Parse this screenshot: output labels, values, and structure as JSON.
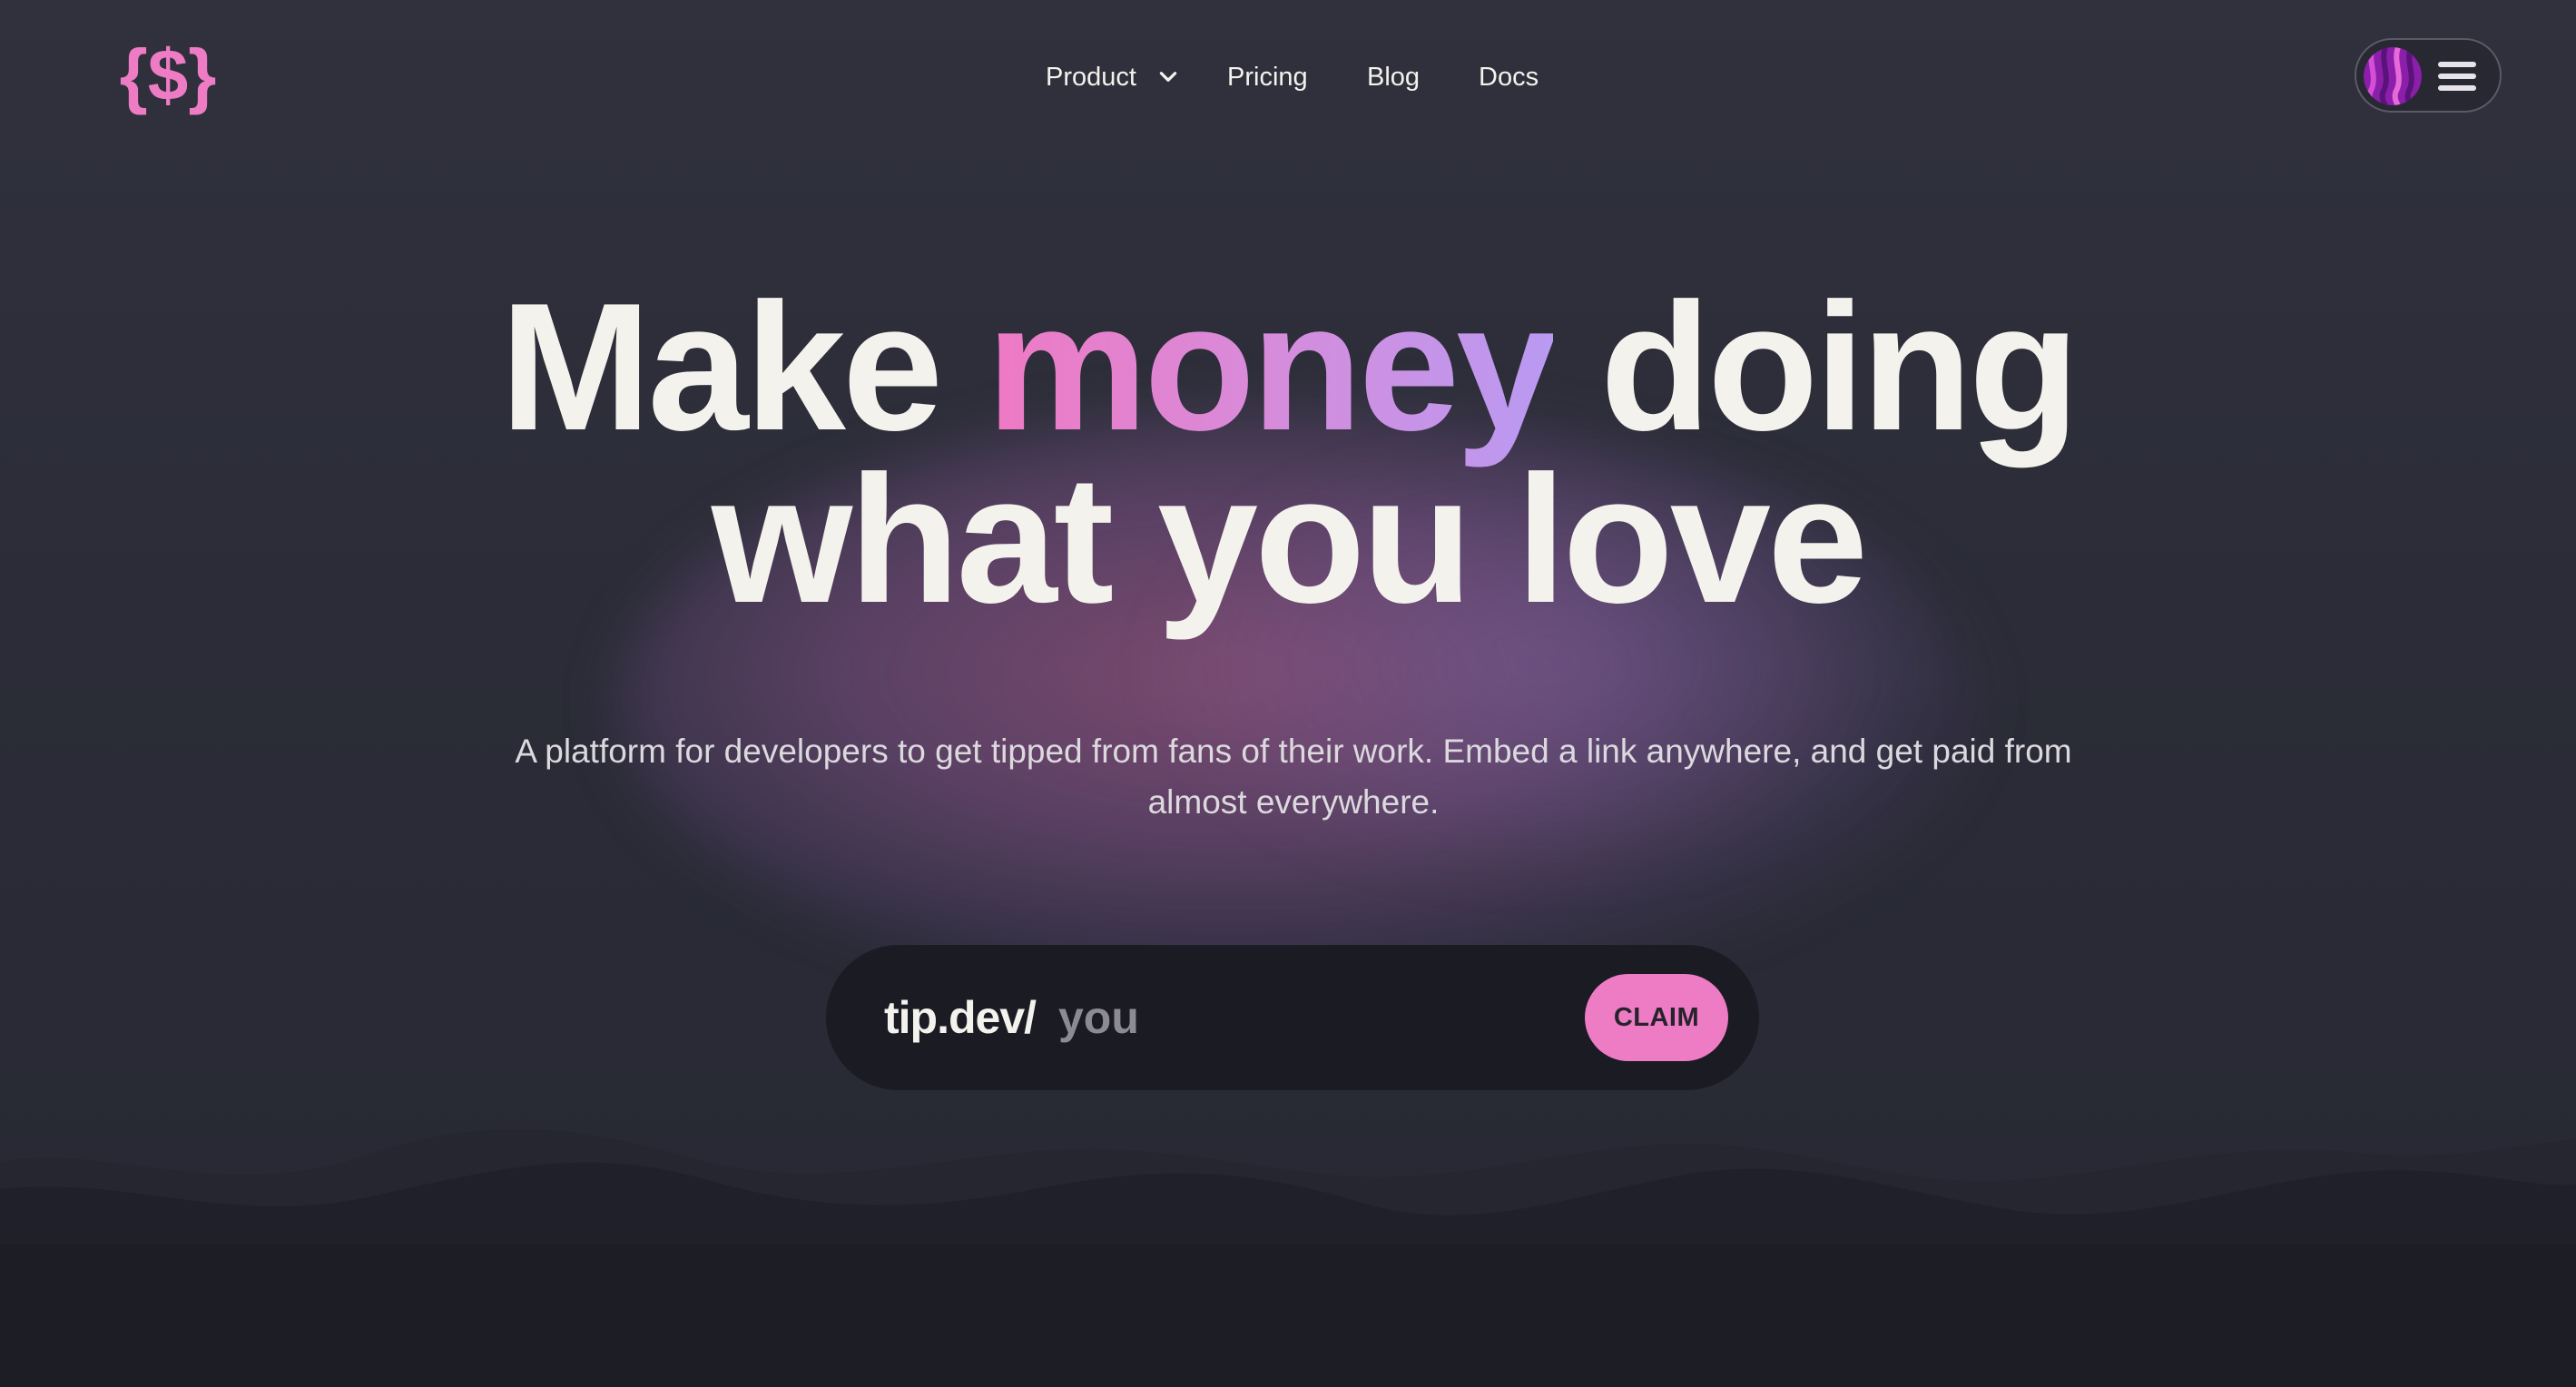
{
  "colors": {
    "background": "#2b2c38",
    "accent_pink": "#ee7cc5",
    "accent_purple": "#b99af2",
    "text": "#f4f2ec",
    "claim_bar": "#1b1b24"
  },
  "header": {
    "logo_icon": "curly-brace-dollar-logo",
    "nav": {
      "product_label": "Product",
      "pricing_label": "Pricing",
      "blog_label": "Blog",
      "docs_label": "Docs"
    },
    "menu_icons": [
      "avatar",
      "hamburger-menu-icon"
    ]
  },
  "hero": {
    "headline": {
      "part1": "Make ",
      "accent": "money",
      "part2": " doing",
      "line2": "what you love"
    },
    "subtitle": "A platform for developers to get tipped from fans of their work. Embed a link anywhere, and get paid from almost everywhere."
  },
  "claim": {
    "prefix": "tip.dev/",
    "placeholder": "you",
    "button_label": "CLAIM"
  }
}
